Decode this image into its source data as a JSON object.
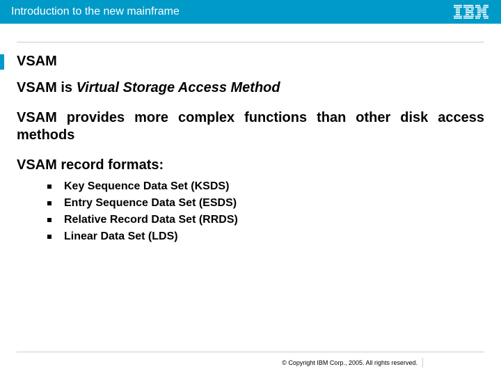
{
  "header": {
    "title": "Introduction to the new mainframe",
    "logo_name": "ibm-logo"
  },
  "slide": {
    "title": "VSAM",
    "p1_prefix": "VSAM is ",
    "p1_emph": "Virtual Storage Access Method",
    "p2": "VSAM provides more complex functions than other disk access methods",
    "p3": "VSAM record formats:",
    "bullets": [
      "Key Sequence Data Set (KSDS)",
      "Entry Sequence Data Set (ESDS)",
      "Relative Record Data Set (RRDS)",
      "Linear Data Set (LDS)"
    ]
  },
  "footer": {
    "copyright": "© Copyright IBM Corp., 2005. All rights reserved."
  }
}
